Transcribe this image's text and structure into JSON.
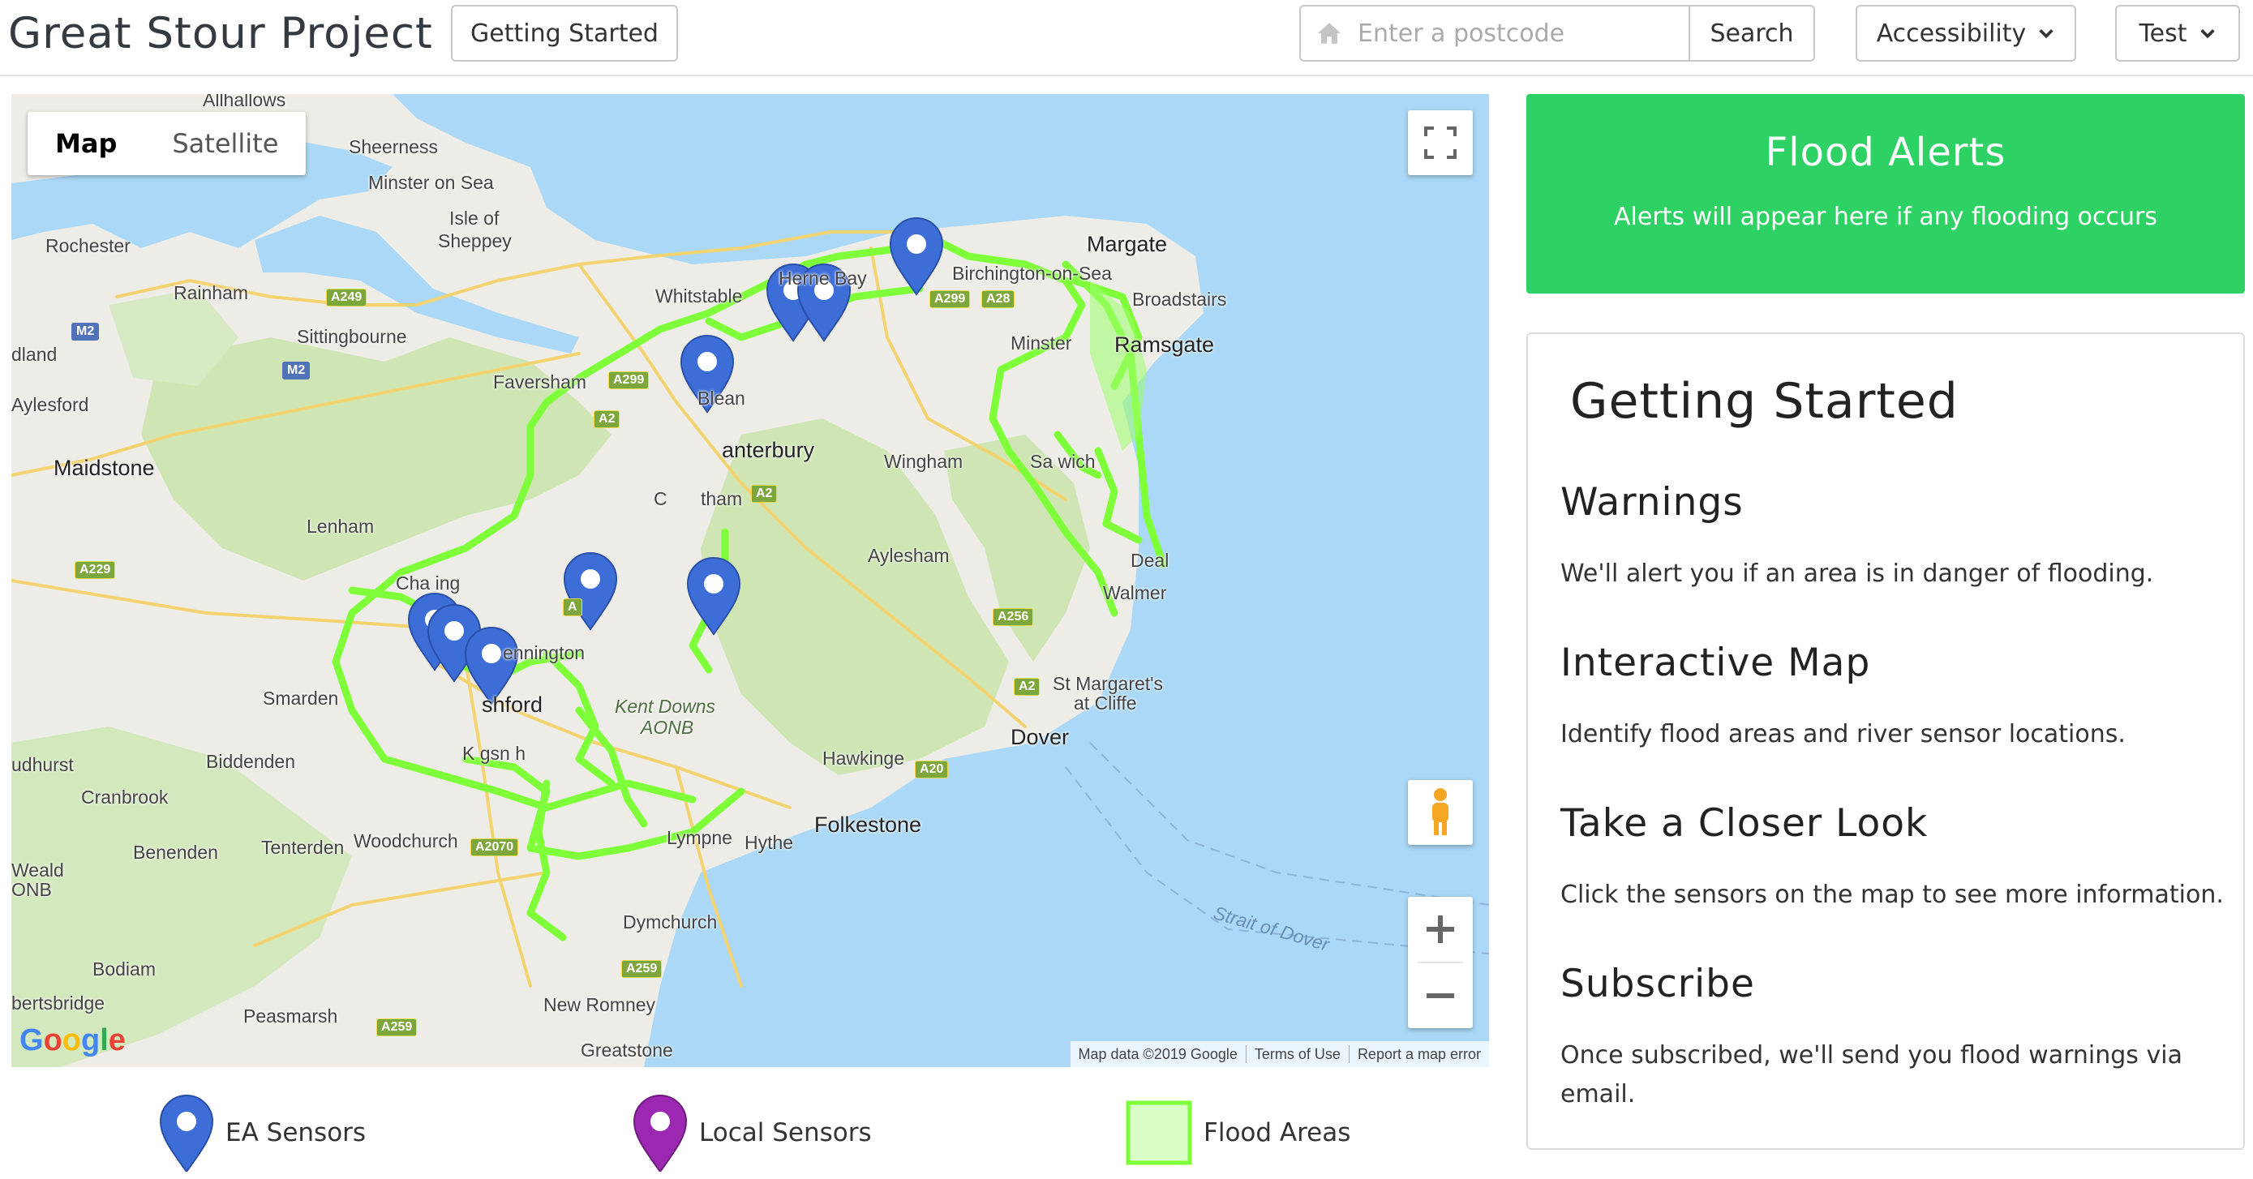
{
  "navbar": {
    "brand": "Great Stour Project",
    "getting_started": "Getting Started",
    "search_placeholder": "Enter a postcode",
    "search_button": "Search",
    "accessibility": "Accessibility",
    "test": "Test"
  },
  "map": {
    "type_map": "Map",
    "type_satellite": "Satellite",
    "google": "Google",
    "attribution": {
      "data": "Map data ©2019 Google",
      "terms": "Terms of Use",
      "report": "Report a map error"
    },
    "places": {
      "allhallows": "Allhallows",
      "sheerness": "Sheerness",
      "minster_on_sea": "Minster on Sea",
      "isle_of": "Isle of",
      "sheppey": "Sheppey",
      "rochester": "Rochester",
      "rainham": "Rainham",
      "sittingbourne": "Sittingbourne",
      "dland": "dland",
      "aylesford": "Aylesford",
      "maidstone": "Maidstone",
      "faversham": "Faversham",
      "whitstable": "Whitstable",
      "herne_bay": "Herne Bay",
      "margate": "Margate",
      "birchington": "Birchington-on-Sea",
      "broadstairs": "Broadstairs",
      "minster": "Minster",
      "ramsgate": "Ramsgate",
      "blean": "Blean",
      "canterbury": "anterbury",
      "chartham": "C",
      "chartham2": "tham",
      "wingham": "Wingham",
      "sandwich": "Sa  wich",
      "lenham": "Lenham",
      "aylesham": "Aylesham",
      "deal": "Deal",
      "walmer": "Walmer",
      "charing": "Cha ing",
      "kennington": "ennington",
      "smarden": "Smarden",
      "ashford": "shford",
      "kent_downs": "Kent Downs",
      "aonb": "AONB",
      "st_margarets": "St Margaret's",
      "at_cliffe": "at Cliffe",
      "biddenden": "Biddenden",
      "udhurst": "udhurst",
      "cranbrook": "Cranbrook",
      "kingsnorth": "K  gsn  h",
      "hawkinge": "Hawkinge",
      "dover": "Dover",
      "benenden": "Benenden",
      "tenterden": "Tenterden",
      "woodchurch": "Woodchurch",
      "lympne": "Lympne",
      "hythe": "Hythe",
      "folkestone": "Folkestone",
      "weald": "Weald",
      "onb": "ONB",
      "dymchurch": "Dymchurch",
      "bodiam": "Bodiam",
      "bertsbridge": "bertsbridge",
      "peasmarsh": "Peasmarsh",
      "new_romney": "New Romney",
      "greatstone": "Greatstone",
      "strait": "Strait of Dover"
    },
    "roads": {
      "a249": "A249",
      "m2a": "M2",
      "m2b": "M2",
      "a299a": "A299",
      "a299b": "A299",
      "a28": "A28",
      "a2a": "A2",
      "a2b": "A2",
      "a2c": "A2",
      "a229": "A229",
      "a256": "A256",
      "a20": "A20",
      "a2070": "A2070",
      "a259a": "A259",
      "a259b": "A259",
      "a28b": "A"
    }
  },
  "legend": {
    "ea_sensors": "EA Sensors",
    "local_sensors": "Local Sensors",
    "flood_areas": "Flood Areas"
  },
  "colors": {
    "ea_marker": "#3d6ed8",
    "local_marker": "#9c27b0",
    "flood": "#7fff3a",
    "alert_green": "#2ed164"
  },
  "alerts": {
    "title": "Flood Alerts",
    "subtitle": "Alerts will appear here if any flooding occurs"
  },
  "getting_started": {
    "title": "Getting Started",
    "sections": [
      {
        "heading": "Warnings",
        "text": "We'll alert you if an area is in danger of flooding."
      },
      {
        "heading": "Interactive Map",
        "text": "Identify flood areas and river sensor locations."
      },
      {
        "heading": "Take a Closer Look",
        "text": "Click the sensors on the map to see more information."
      },
      {
        "heading": "Subscribe",
        "text": "Once subscribed, we'll send you flood warnings via email."
      }
    ]
  }
}
